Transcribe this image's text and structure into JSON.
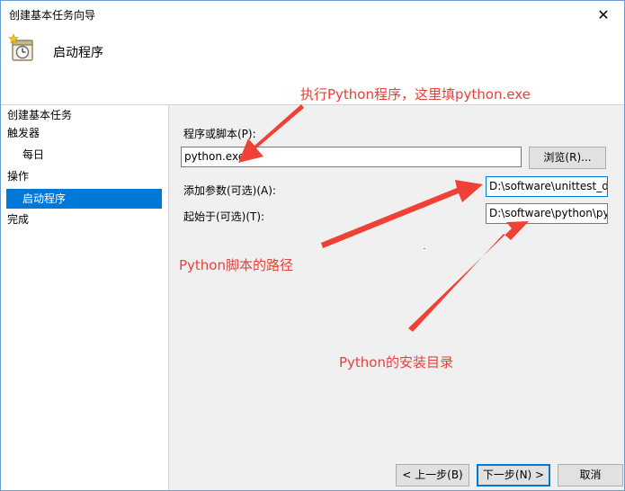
{
  "window": {
    "title": "创建基本任务向导",
    "close_symbol": "✕"
  },
  "header": {
    "icon": "task-clock-icon",
    "title": "启动程序"
  },
  "sidebar": {
    "items": [
      {
        "label": "创建基本任务",
        "indent": 0,
        "selected": false
      },
      {
        "label": "触发器",
        "indent": 0,
        "selected": false
      },
      {
        "label": "每日",
        "indent": 1,
        "selected": false
      },
      {
        "label": "操作",
        "indent": 0,
        "selected": false
      },
      {
        "label": "启动程序",
        "indent": 1,
        "selected": true
      },
      {
        "label": "完成",
        "indent": 0,
        "selected": false
      }
    ]
  },
  "form": {
    "program_label": "程序或脚本(P):",
    "program_value": "python.exe",
    "browse_label": "浏览(R)...",
    "args_label": "添加参数(可选)(A):",
    "args_value": "D:\\software\\unittest_de",
    "start_label": "起始于(可选)(T):",
    "start_value": "D:\\software\\python\\py"
  },
  "footer": {
    "back_label": "< 上一步(B)",
    "next_label": "下一步(N) >",
    "cancel_label": "取消"
  },
  "annotations": {
    "program_note": "执行Python程序，这里填python.exe",
    "args_note": "Python脚本的路径",
    "start_note": "Python的安装目录",
    "color": "#e8413b"
  },
  "colors": {
    "selection": "#0078d7",
    "content_bg": "#f0f0f0"
  }
}
